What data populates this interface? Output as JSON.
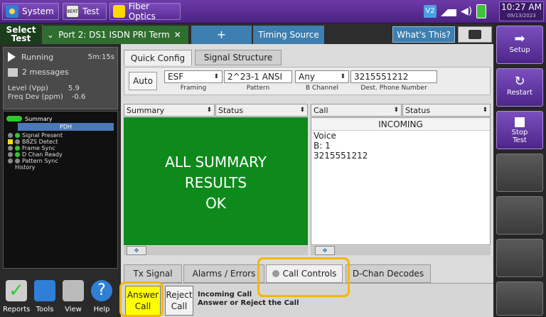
{
  "topbar": {
    "system_label": "System",
    "test_label": "Test",
    "fiber_label": "Fiber Optics",
    "time": "10:27 AM",
    "date": "09/13/2023"
  },
  "tabs": {
    "select_test": "Select Test",
    "port_tab": "Port 2: DS1 ISDN PRI Term",
    "add_tab": "+",
    "timing_tab": "Timing Source",
    "whats_this": "What's This?"
  },
  "status": {
    "state": "Running",
    "elapsed": "5m:15s",
    "messages": "2 messages",
    "level_label": "Level (Vpp)",
    "level_value": "5.9",
    "freq_label": "Freq Dev (ppm)",
    "freq_value": "-0.6"
  },
  "tree": {
    "summary": "Summary",
    "pdh": "PDH",
    "items": [
      "Signal Present",
      "B8ZS Detect",
      "Frame Sync",
      "D Chan Ready",
      "Pattern Sync",
      "History"
    ]
  },
  "tools": {
    "reports": "Reports",
    "tools": "Tools",
    "view": "View",
    "help": "Help"
  },
  "quick": {
    "tab_quick": "Quick Config",
    "tab_signal": "Signal Structure",
    "auto": "Auto",
    "framing_value": "ESF",
    "framing_label": "Framing",
    "pattern_value": "2^23-1 ANSI",
    "pattern_label": "Pattern",
    "bchannel_value": "Any",
    "bchannel_label": "B Channel",
    "phone_value": "3215551212",
    "phone_label": "Dest. Phone Number"
  },
  "panes": {
    "left_sel1": "Summary",
    "left_sel2": "Status",
    "right_sel1": "Call",
    "right_sel2": "Status",
    "summary_line1": "ALL SUMMARY",
    "summary_line2": "RESULTS",
    "summary_line3": "OK",
    "incoming": "INCOMING",
    "call_type": "Voice",
    "call_b": "B: 1",
    "call_number": "3215551212"
  },
  "bottom_tabs": {
    "tx_signal": "Tx Signal",
    "alarms": "Alarms / Errors",
    "call_controls": "Call Controls",
    "dchan": "D-Chan Decodes"
  },
  "call_controls": {
    "answer_line1": "Answer",
    "answer_line2": "Call",
    "reject_line1": "Reject",
    "reject_line2": "Call",
    "info_line1": "Incoming Call",
    "info_line2": "Answer or Reject the Call"
  },
  "right_buttons": {
    "setup": "Setup",
    "restart": "Restart",
    "stop_line1": "Stop",
    "stop_line2": "Test"
  },
  "colors": {
    "accent_purple": "#5a2c95",
    "summary_green": "#0e8a1d",
    "highlight": "#f2b800",
    "answer_yellow": "#ffff00"
  }
}
